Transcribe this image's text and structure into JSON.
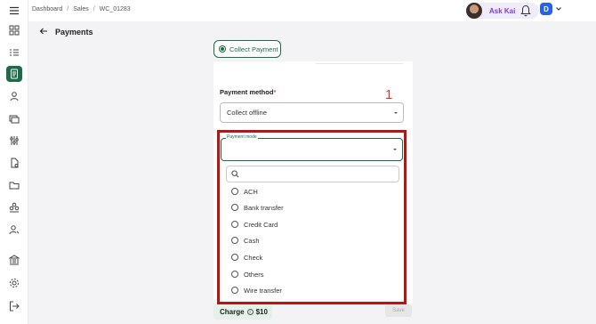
{
  "breadcrumb": [
    "Dashboard",
    "Sales",
    "WC_01283"
  ],
  "header": {
    "ask_label": "Ask Kai",
    "user_initial": "D"
  },
  "page": {
    "title": "Payments"
  },
  "collect": {
    "label": "Collect Payment"
  },
  "payment_method": {
    "label": "Payment method",
    "required_mark": "*",
    "value": "Collect offline"
  },
  "annotation": {
    "number": "1"
  },
  "payment_mode": {
    "legend": "Payment mode",
    "search_placeholder": "",
    "options": [
      "ACH",
      "Bank transfer",
      "Credit Card",
      "Cash",
      "Check",
      "Others",
      "Wire transfer"
    ]
  },
  "footer": {
    "charge_label": "Charge",
    "info": "i",
    "amount": "$10",
    "save_label": "Save"
  },
  "colors": {
    "brand": "#1e6b4a",
    "annotation": "#b01818",
    "ask_kai": "#7c3aed"
  },
  "icons": [
    "menu-icon",
    "dashboard-icon",
    "list-icon",
    "document-icon",
    "person-icon",
    "billing-icon",
    "sliders-icon",
    "file-icon",
    "folder-icon",
    "team-icon",
    "user-edit-icon",
    "bank-icon",
    "settings-icon",
    "logout-icon"
  ]
}
